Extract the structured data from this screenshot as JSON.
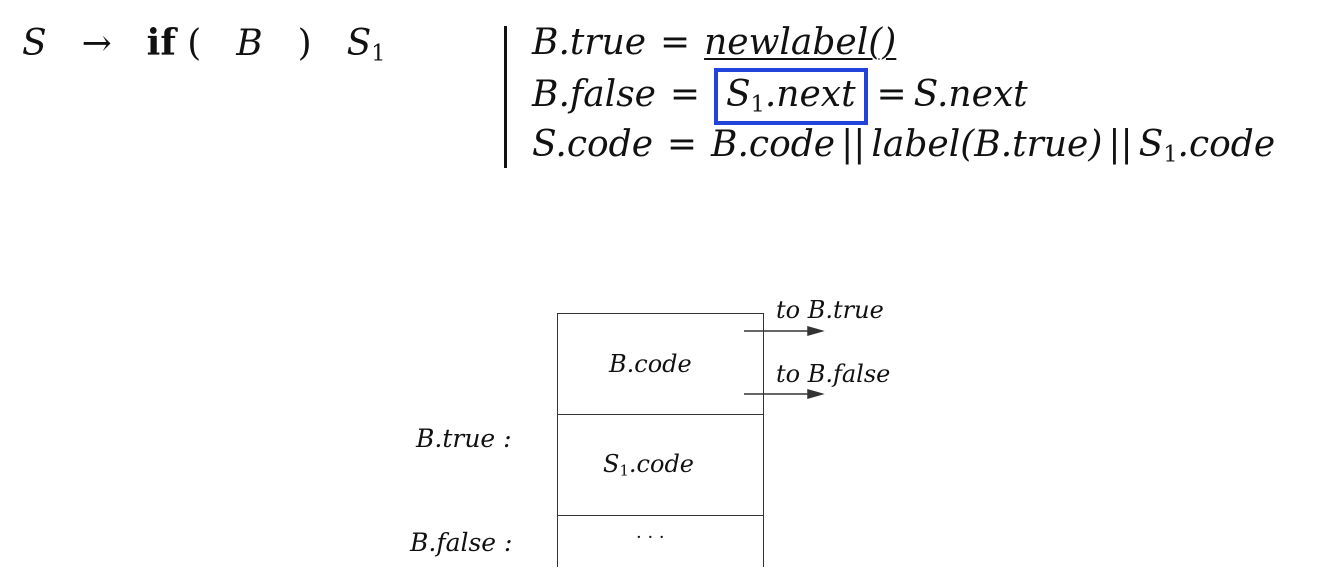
{
  "production": {
    "lhs": "S",
    "arrow": "→",
    "keyword": "if",
    "lparen": "(",
    "cond": "B",
    "rparen": ")",
    "body_base": "S",
    "body_sub": "1"
  },
  "rules": {
    "r1": {
      "lhs": "B.true",
      "eq": "=",
      "rhs": "newlabel()"
    },
    "r2": {
      "lhs": "B.false",
      "eq": "=",
      "mid_base": "S",
      "mid_sub": "1",
      "mid_tail": ".next",
      "eq2": "=",
      "rhs": "S.next"
    },
    "r3": {
      "lhs": "S.code",
      "eq": "=",
      "part1": "B.code",
      "bars1": "||",
      "part2": "label(B.true)",
      "bars2": "||",
      "part3_base": "S",
      "part3_sub": "1",
      "part3_tail": ".code"
    }
  },
  "highlight_color": "#2244dd",
  "diagram": {
    "cell1": "B.code",
    "cell2_base": "S",
    "cell2_sub": "1",
    "cell2_tail": ".code",
    "cell3": "· · ·",
    "label_true": "B.true :",
    "label_false": "B.false :",
    "arrow_true": "to B.true",
    "arrow_false": "to B.false"
  }
}
